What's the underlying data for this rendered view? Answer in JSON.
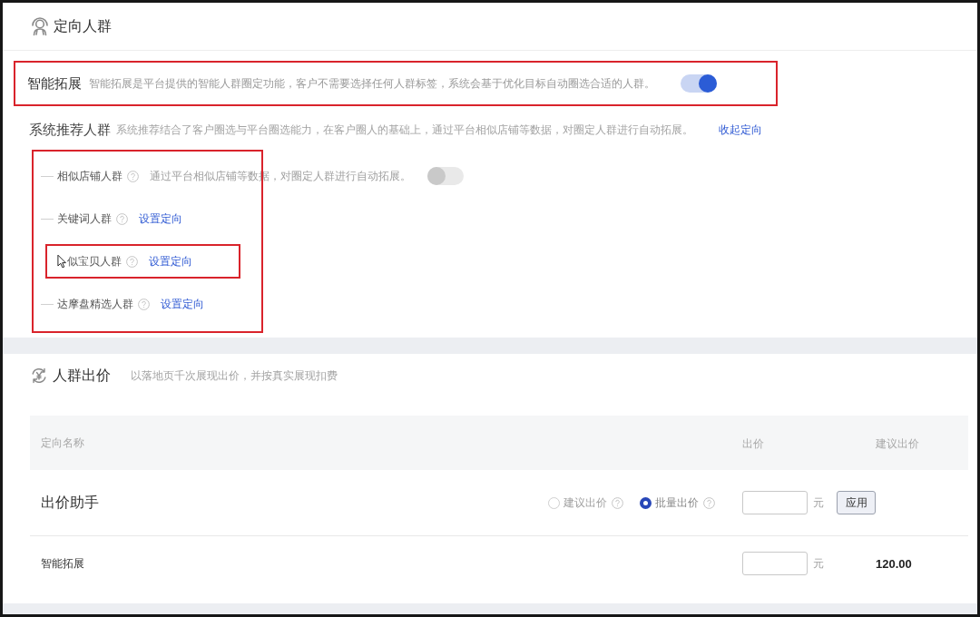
{
  "targeting": {
    "title": "定向人群",
    "smart_expansion": {
      "label": "智能拓展",
      "description": "智能拓展是平台提供的智能人群圈定功能，客户不需要选择任何人群标签，系统会基于优化目标自动圈选合适的人群。",
      "on": true,
      "highlighted": true
    },
    "system_recommended": {
      "label": "系统推荐人群",
      "description": "系统推荐结合了客户圈选与平台圈选能力，在客户圈人的基础上，通过平台相似店铺等数据，对圈定人群进行自动拓展。",
      "link": "收起定向"
    },
    "audiences_highlighted": true,
    "audiences": [
      {
        "kind": "toggle",
        "label": "相似店铺人群",
        "description": "通过平台相似店铺等数据，对圈定人群进行自动拓展。",
        "on": false,
        "highlighted": false
      },
      {
        "kind": "link",
        "label": "关键词人群",
        "link": "设置定向",
        "highlighted": false
      },
      {
        "kind": "link",
        "label": "似宝贝人群",
        "link": "设置定向",
        "highlighted": true,
        "cursor": true
      },
      {
        "kind": "link",
        "label": "达摩盘精选人群",
        "link": "设置定向",
        "highlighted": false
      }
    ]
  },
  "bidding": {
    "title": "人群出价",
    "subtitle": "以落地页千次展现出价，并按真实展现扣费",
    "table": {
      "columns": [
        "定向名称",
        "出价",
        "建议出价"
      ],
      "rows": [
        {
          "kind": "assistant",
          "name": "出价助手",
          "options": [
            {
              "label": "建议出价",
              "selected": false
            },
            {
              "label": "批量出价",
              "selected": true
            }
          ],
          "unit": "元",
          "button": "应用"
        },
        {
          "kind": "target",
          "name": "智能拓展",
          "unit": "元",
          "suggested": "120.00"
        }
      ]
    }
  }
}
